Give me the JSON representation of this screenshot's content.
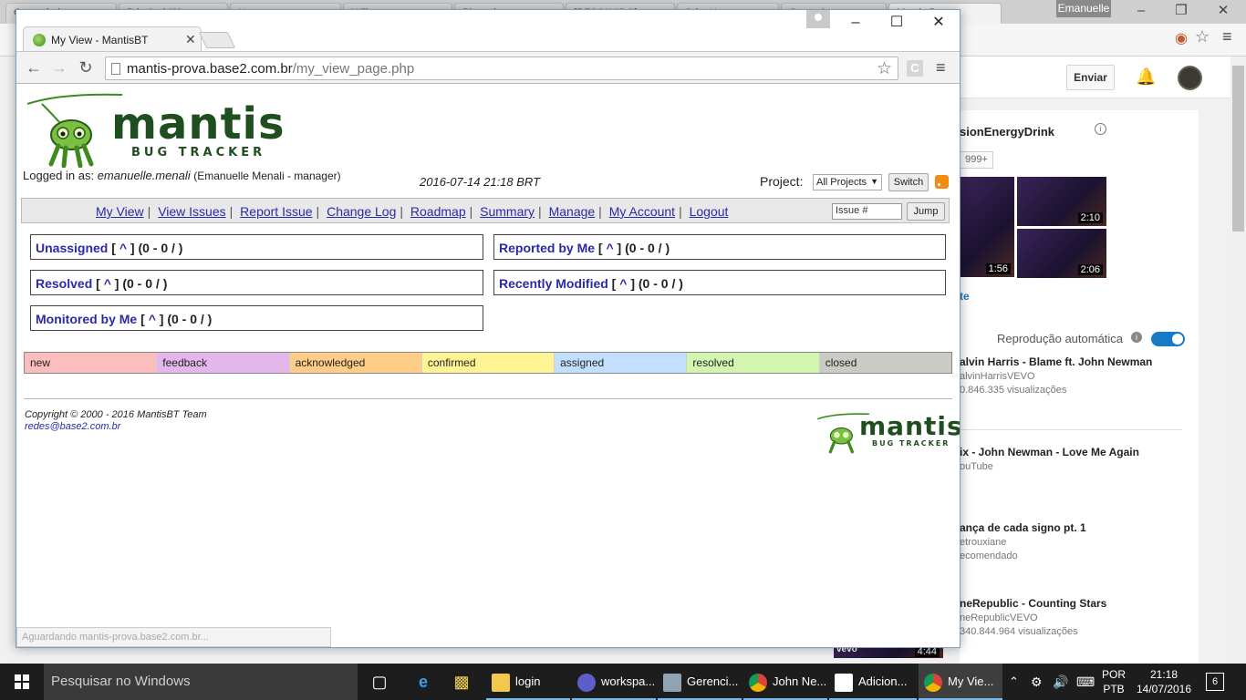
{
  "background_browser": {
    "tabs": [
      "Gerenciador",
      "Principal (Sit...",
      "Novo",
      "Utilize ...",
      "Bloqueio...",
      "[RESOLVIDO]...",
      "John Newman",
      "Gerenciam...",
      "Mantis Pro"
    ],
    "user_name": "Emanuelle",
    "youtube": {
      "send_label": "Enviar",
      "channel_name": "sionEnergyDrink",
      "channel_count": "999+",
      "thumb_durations": [
        "1:56",
        "2:10",
        "2:06"
      ],
      "more_link": "te",
      "autoplay_label": "Reprodução automática",
      "videos": [
        {
          "title": "alvin Harris - Blame ft. John Newman",
          "channel": "alvinHarrisVEVO",
          "views": "0.846.335 visualizações"
        },
        {
          "title": "ix - John Newman - Love Me Again",
          "channel": "ouTube",
          "views": ""
        },
        {
          "title": "ança de cada signo pt. 1",
          "channel": "etrouxiane",
          "views": "ecomendado"
        },
        {
          "title": "neRepublic - Counting Stars",
          "channel": "neRepublicVEVO",
          "views": "340.844.964 visualizações"
        }
      ],
      "bottom_duration": "4:44",
      "bottom_badge": "vevo"
    }
  },
  "window": {
    "tab_title": "My View - MantisBT",
    "url_host": "mantis-prova.base2.com.br",
    "url_path": "/my_view_page.php",
    "ext_letter": "C"
  },
  "mantis": {
    "logo_word": "mantis",
    "logo_sub": "BUG TRACKER",
    "logged_in_prefix": "Logged in as:",
    "logged_in_user": "emanuelle.menali",
    "logged_in_full": "(Emanuelle Menali - manager)",
    "date": "2016-07-14 21:18 BRT",
    "project_label": "Project:",
    "project_value": "All Projects",
    "switch_label": "Switch",
    "menu": [
      "My View",
      "View Issues",
      "Report Issue",
      "Change Log",
      "Roadmap",
      "Summary",
      "Manage",
      "My Account",
      "Logout"
    ],
    "issue_placeholder": "Issue #",
    "jump_label": "Jump",
    "boxes": [
      {
        "title": "Unassigned",
        "link": "^",
        "count": "(0 - 0 / )"
      },
      {
        "title": "Reported by Me",
        "link": "^",
        "count": "(0 - 0 / )"
      },
      {
        "title": "Resolved",
        "link": "^",
        "count": "(0 - 0 / )"
      },
      {
        "title": "Recently Modified",
        "link": "^",
        "count": "(0 - 0 / )"
      },
      {
        "title": "Monitored by Me",
        "link": "^",
        "count": "(0 - 0 / )"
      }
    ],
    "legend": [
      {
        "label": "new",
        "color": "#fcbdbd"
      },
      {
        "label": "feedback",
        "color": "#e3b7eb"
      },
      {
        "label": "acknowledged",
        "color": "#ffcd85"
      },
      {
        "label": "confirmed",
        "color": "#fff494"
      },
      {
        "label": "assigned",
        "color": "#c2dfff"
      },
      {
        "label": "resolved",
        "color": "#d2f5b0"
      },
      {
        "label": "closed",
        "color": "#c9ccc4"
      }
    ],
    "copyright": "Copyright © 2000 - 2016 MantisBT Team",
    "contact": "redes@base2.com.br",
    "status_text": "Aguardando mantis-prova.base2.com.br..."
  },
  "taskbar": {
    "search_placeholder": "Pesquisar no Windows",
    "apps": [
      "login",
      "workspa...",
      "Gerenci...",
      "John Ne...",
      "Adicion...",
      "My Vie..."
    ],
    "lang_top": "POR",
    "lang_bottom": "PTB",
    "time": "21:18",
    "date": "14/07/2016",
    "notifications": "6"
  },
  "colors": {
    "link": "#2a2aa8",
    "logo_green": "#1f4e1f",
    "taskbar": "#1d1d1d",
    "accent_blue": "#167ac6"
  }
}
